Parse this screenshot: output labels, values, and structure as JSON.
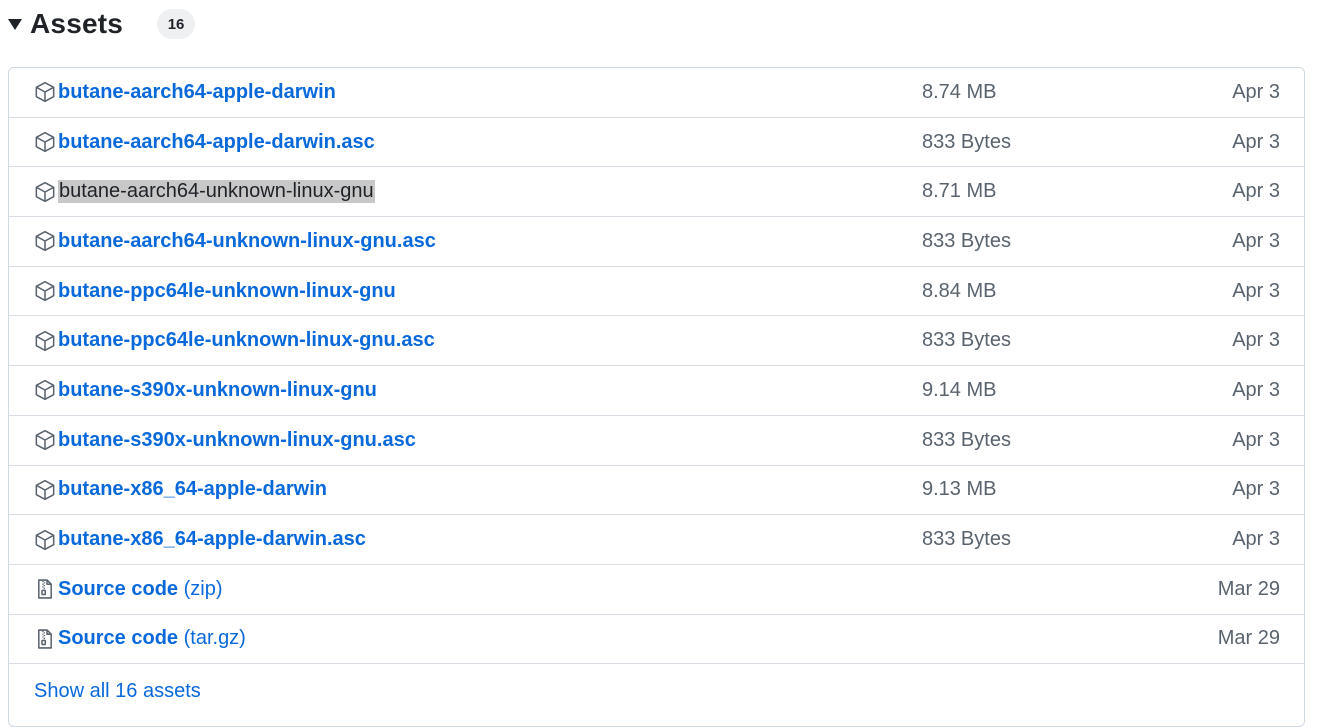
{
  "header": {
    "title": "Assets",
    "count": "16"
  },
  "assets": [
    {
      "name": "butane-aarch64-apple-darwin",
      "size": "8.74 MB",
      "date": "Apr 3",
      "icon": "package-icon"
    },
    {
      "name": "butane-aarch64-apple-darwin.asc",
      "size": "833 Bytes",
      "date": "Apr 3",
      "icon": "package-icon"
    },
    {
      "name": "butane-aarch64-unknown-linux-gnu",
      "size": "8.71 MB",
      "date": "Apr 3",
      "icon": "package-icon",
      "selected": true
    },
    {
      "name": "butane-aarch64-unknown-linux-gnu.asc",
      "size": "833 Bytes",
      "date": "Apr 3",
      "icon": "package-icon"
    },
    {
      "name": "butane-ppc64le-unknown-linux-gnu",
      "size": "8.84 MB",
      "date": "Apr 3",
      "icon": "package-icon"
    },
    {
      "name": "butane-ppc64le-unknown-linux-gnu.asc",
      "size": "833 Bytes",
      "date": "Apr 3",
      "icon": "package-icon"
    },
    {
      "name": "butane-s390x-unknown-linux-gnu",
      "size": "9.14 MB",
      "date": "Apr 3",
      "icon": "package-icon"
    },
    {
      "name": "butane-s390x-unknown-linux-gnu.asc",
      "size": "833 Bytes",
      "date": "Apr 3",
      "icon": "package-icon"
    },
    {
      "name": "butane-x86_64-apple-darwin",
      "size": "9.13 MB",
      "date": "Apr 3",
      "icon": "package-icon"
    },
    {
      "name": "butane-x86_64-apple-darwin.asc",
      "size": "833 Bytes",
      "date": "Apr 3",
      "icon": "package-icon"
    }
  ],
  "source": [
    {
      "label": "Source code",
      "ext": "(zip)",
      "date": "Mar 29",
      "icon": "file-zip-icon"
    },
    {
      "label": "Source code",
      "ext": "(tar.gz)",
      "date": "Mar 29",
      "icon": "file-zip-icon"
    }
  ],
  "footer": {
    "show_all": "Show all 16 assets"
  },
  "colors": {
    "link": "#0969da",
    "muted": "#59636e",
    "border": "#d1d9e0",
    "selection": "#c8c8c8"
  }
}
